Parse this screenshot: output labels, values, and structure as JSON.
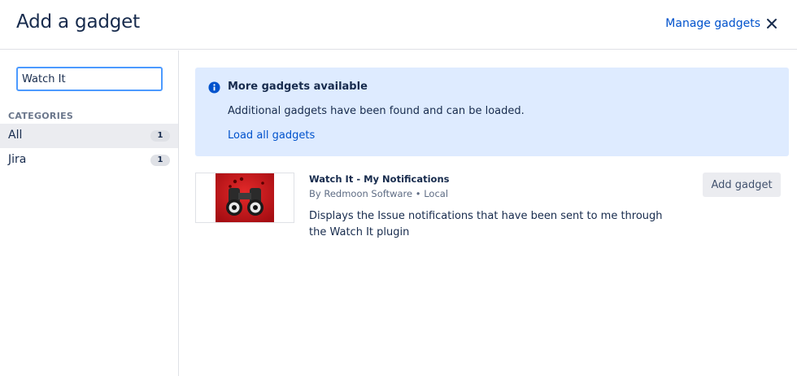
{
  "header": {
    "title": "Add a gadget",
    "manage_link": "Manage gadgets"
  },
  "sidebar": {
    "search_value": "Watch It",
    "categories_heading": "CATEGORIES",
    "categories": [
      {
        "label": "All",
        "count": "1",
        "selected": true
      },
      {
        "label": "Jira",
        "count": "1",
        "selected": false
      }
    ]
  },
  "info_banner": {
    "title": "More gadgets available",
    "description": "Additional gadgets have been found and can be loaded.",
    "link": "Load all gadgets"
  },
  "gadgets": [
    {
      "name": "Watch It - My Notifications",
      "meta": "By Redmoon Software • Local",
      "description": "Displays the Issue notifications that have been sent to me through the Watch It plugin",
      "add_label": "Add gadget",
      "thumbnail": "binoculars-icon"
    }
  ],
  "colors": {
    "link": "#0052cc",
    "info_bg": "#deebff",
    "focus_border": "#4c9aff",
    "thumb_red": "#c8141c"
  }
}
